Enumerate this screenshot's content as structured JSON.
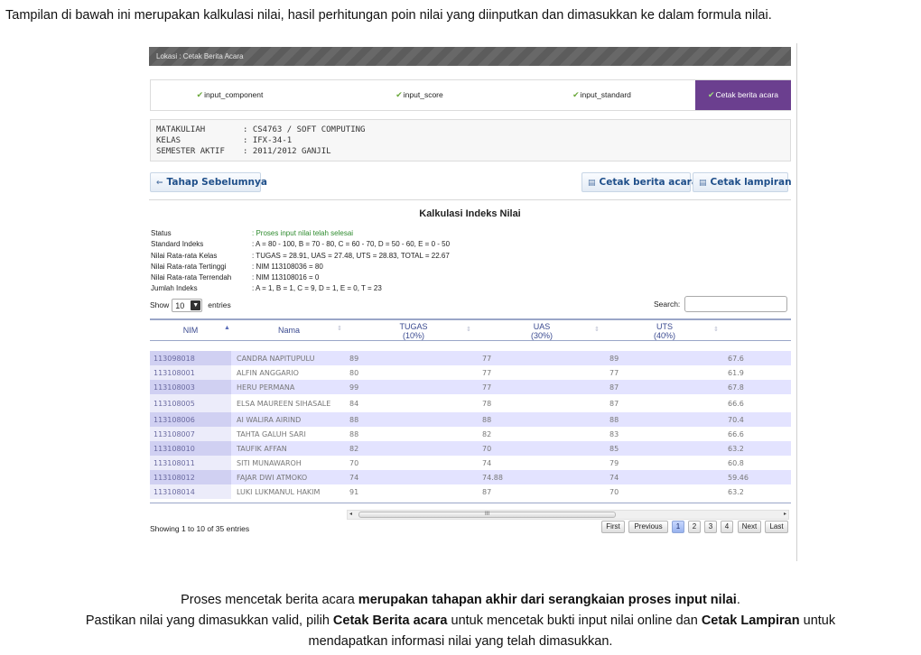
{
  "caption_top": "Tampilan di bawah ini merupakan kalkulasi nilai, hasil perhitungan poin nilai yang diinputkan dan dimasukkan ke dalam formula nilai.",
  "location": "Lokasi : Cetak Berita Acara",
  "steps": [
    {
      "label": "input_component",
      "check": "✔",
      "active": false
    },
    {
      "label": "input_score",
      "check": "✔",
      "active": false
    },
    {
      "label": "input_standard",
      "check": "✔",
      "active": false
    },
    {
      "label": "Cetak berita acara",
      "check": "✔",
      "active": true
    }
  ],
  "course": [
    {
      "key": "MATAKULIAH",
      "value": ": CS4763 / SOFT COMPUTING"
    },
    {
      "key": "KELAS",
      "value": ": IFX-34-1"
    },
    {
      "key": "SEMESTER AKTIF",
      "value": ": 2011/2012 GANJIL"
    }
  ],
  "buttons": {
    "back_label": "Tahap Sebelumnya",
    "back_icon": "arrow-left-icon",
    "print_berita_label": "Cetak berita acara",
    "print_lampiran_label": "Cetak lampiran",
    "print_icon": "printer-icon"
  },
  "calc_title": "Kalkulasi Indeks Nilai",
  "stats": [
    {
      "key": "Status",
      "value": ": Proses input nilai telah selesai",
      "green": true
    },
    {
      "key": "Standard Indeks",
      "value": ": A = 80 - 100, B = 70 - 80, C = 60 - 70, D = 50 - 60, E = 0 - 50",
      "green": false
    },
    {
      "key": "Nilai Rata-rata Kelas",
      "value": ": TUGAS = 28.91, UAS = 27.48, UTS = 28.83, TOTAL = 22.67",
      "green": false
    },
    {
      "key": "Nilai Rata-rata Tertinggi",
      "value": ": NIM 113108036 = 80",
      "green": false
    },
    {
      "key": "Nilai Rata-rata Terrendah",
      "value": ": NIM 113108016 = 0",
      "green": false
    },
    {
      "key": "Jumlah Indeks",
      "value": ": A = 1, B = 1, C = 9, D = 1, E = 0, T = 23",
      "green": false
    }
  ],
  "table_controls": {
    "show_label": "Show",
    "entries_value": "10",
    "entries_label": "entries",
    "search_label": "Search:"
  },
  "columns": {
    "nim": "NIM",
    "nama": "Nama",
    "tugas": "TUGAS",
    "tugas_pct": "(10%)",
    "uas": "UAS",
    "uas_pct": "(30%)",
    "uts": "UTS",
    "uts_pct": "(40%)"
  },
  "rows": [
    {
      "nim": "113098018",
      "nama": "CANDRA NAPITUPULU",
      "tugas": "89",
      "uas": "77",
      "uts": "89",
      "total": "67.6"
    },
    {
      "nim": "113108001",
      "nama": "ALFIN ANGGARIO",
      "tugas": "80",
      "uas": "77",
      "uts": "77",
      "total": "61.9"
    },
    {
      "nim": "113108003",
      "nama": "HERU PERMANA",
      "tugas": "99",
      "uas": "77",
      "uts": "87",
      "total": "67.8"
    },
    {
      "nim": "113108005",
      "nama": "ELSA MAUREEN SIHASALE",
      "tugas": "84",
      "uas": "78",
      "uts": "87",
      "total": "66.6"
    },
    {
      "nim": "113108006",
      "nama": "AI WALIRA AIRIND",
      "tugas": "88",
      "uas": "88",
      "uts": "88",
      "total": "70.4"
    },
    {
      "nim": "113108007",
      "nama": "TAHTA GALUH SARI",
      "tugas": "88",
      "uas": "82",
      "uts": "83",
      "total": "66.6"
    },
    {
      "nim": "113108010",
      "nama": "TAUFIK AFFAN",
      "tugas": "82",
      "uas": "70",
      "uts": "85",
      "total": "63.2"
    },
    {
      "nim": "113108011",
      "nama": "SITI MUNAWAROH",
      "tugas": "70",
      "uas": "74",
      "uts": "79",
      "total": "60.8"
    },
    {
      "nim": "113108012",
      "nama": "FAJAR DWI ATMOKO",
      "tugas": "74",
      "uas": "74.88",
      "uts": "74",
      "total": "59.46"
    },
    {
      "nim": "113108014",
      "nama": "LUKI LUKMANUL HAKIM",
      "tugas": "91",
      "uas": "87",
      "uts": "70",
      "total": "63.2"
    }
  ],
  "scroll": {
    "left": "◂",
    "right": "▸",
    "grip": "III"
  },
  "showing_text": "Showing 1 to 10 of 35 entries",
  "pagination": {
    "first": "First",
    "previous": "Previous",
    "pages": [
      "1",
      "2",
      "3",
      "4"
    ],
    "current_page": "1",
    "next": "Next",
    "last": "Last"
  },
  "caption_bottom": {
    "line1_a": "Proses mencetak berita acara ",
    "line1_b": "merupakan tahapan akhir dari serangkaian proses input nilai",
    "line1_c": ".",
    "line2_a": "Pastikan nilai yang dimasukkan valid, pilih ",
    "line2_b": "Cetak Berita acara",
    "line2_c": " untuk mencetak bukti input nilai online dan ",
    "line2_d": "Cetak Lampiran",
    "line2_e": " untuk",
    "line3": "mendapatkan informasi nilai yang telah dimasukkan."
  }
}
